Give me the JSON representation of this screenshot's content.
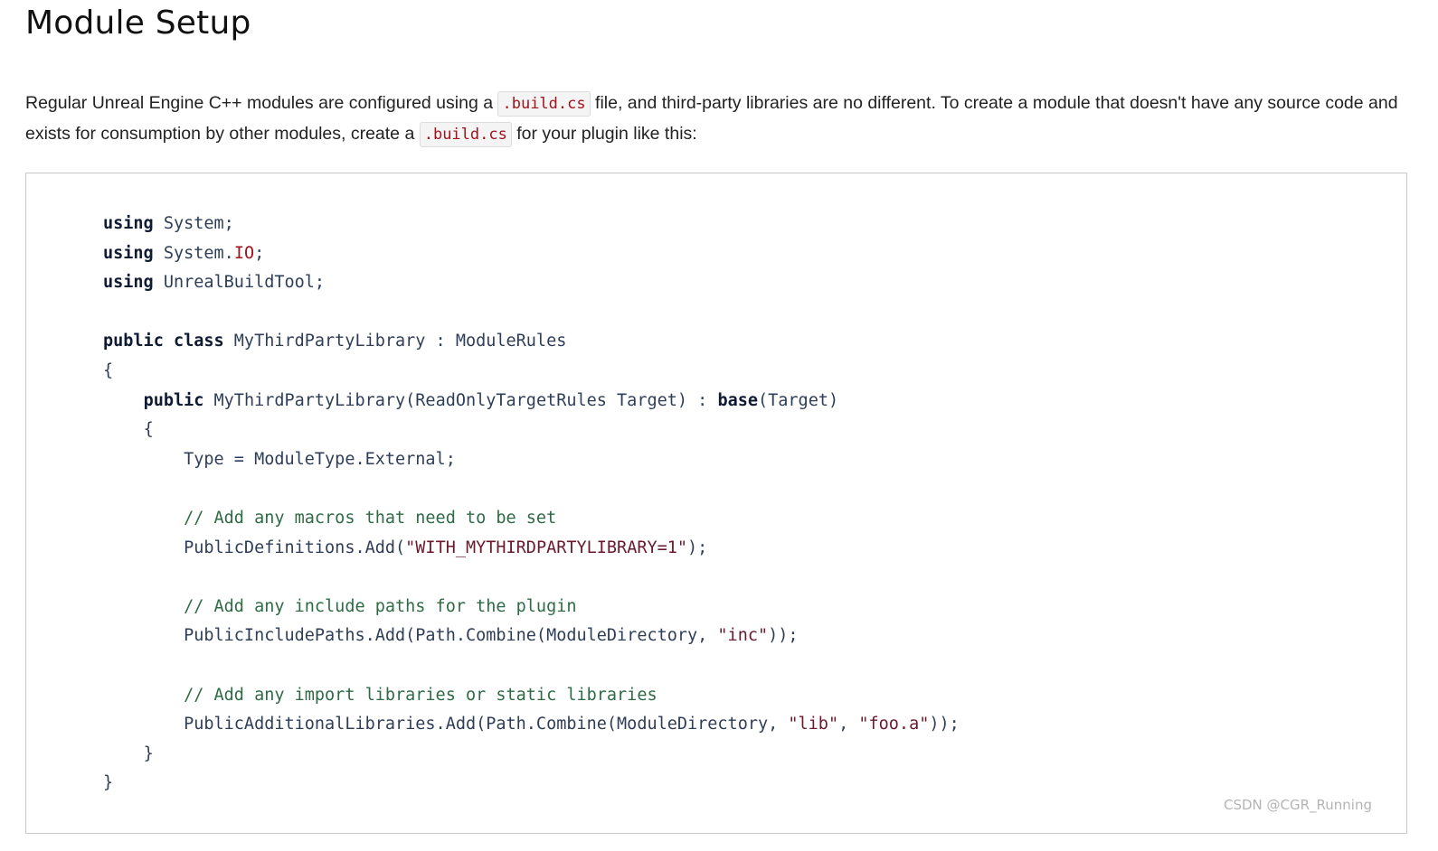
{
  "title": "Module Setup",
  "intro": {
    "part1": "Regular Unreal Engine C++ modules are configured using a ",
    "code1": ".build.cs",
    "part2": " file, and third-party libraries are no different. To create a module that doesn't have any source code and exists for consumption by other modules, create a ",
    "code2": ".build.cs",
    "part3": " for your plugin like this:"
  },
  "code": {
    "l1_kw": "using",
    "l1_rest": " System;",
    "l2_kw": "using",
    "l2_a": " System.",
    "l2_io": "IO",
    "l2_b": ";",
    "l3_kw": "using",
    "l3_rest": " UnrealBuildTool;",
    "l5_kw": "public class",
    "l5_rest": " MyThirdPartyLibrary : ModuleRules",
    "l6": "{",
    "l7_kw": "public",
    "l7_a": " MyThirdPartyLibrary(ReadOnlyTargetRules Target) : ",
    "l7_base": "base",
    "l7_b": "(Target)",
    "l8": "{",
    "l9": "Type = ModuleType.External;",
    "l11_comment": "// Add any macros that need to be set",
    "l12_a": "PublicDefinitions.Add(",
    "l12_str": "\"WITH_MYTHIRDPARTYLIBRARY=1\"",
    "l12_b": ");",
    "l14_comment": "// Add any include paths for the plugin",
    "l15_a": "PublicIncludePaths.Add(Path.Combine(ModuleDirectory, ",
    "l15_str": "\"inc\"",
    "l15_b": "));",
    "l17_comment": "// Add any import libraries or static libraries",
    "l18_a": "PublicAdditionalLibraries.Add(Path.Combine(ModuleDirectory, ",
    "l18_str1": "\"lib\"",
    "l18_sep": ", ",
    "l18_str2": "\"foo.a\"",
    "l18_b": "));",
    "l19": "}",
    "l20": "}"
  },
  "watermark": "CSDN @CGR_Running"
}
